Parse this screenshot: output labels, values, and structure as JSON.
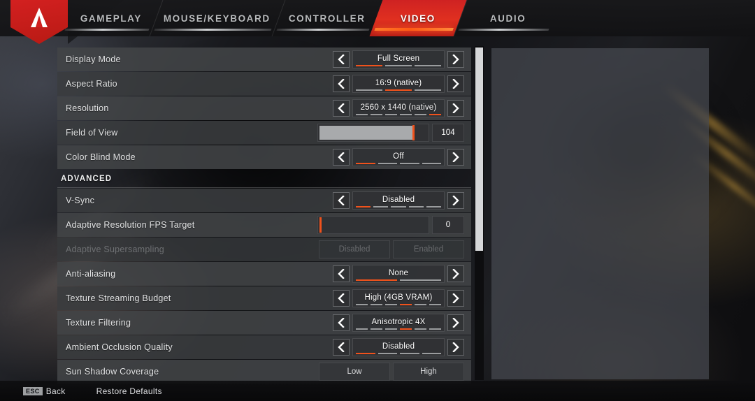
{
  "app": {
    "logo_icon": "apex-legends-logo-icon"
  },
  "tabs": [
    {
      "label": "GAMEPLAY",
      "active": false
    },
    {
      "label": "MOUSE/KEYBOARD",
      "active": false
    },
    {
      "label": "CONTROLLER",
      "active": false
    },
    {
      "label": "VIDEO",
      "active": true
    },
    {
      "label": "AUDIO",
      "active": false
    }
  ],
  "sections": [
    {
      "header": null,
      "rows": [
        {
          "label": "Display Mode",
          "type": "spinner",
          "value": "Full Screen",
          "segments": 3,
          "active_segment": 1,
          "disabled": false
        },
        {
          "label": "Aspect Ratio",
          "type": "spinner",
          "value": "16:9 (native)",
          "segments": 3,
          "active_segment": 2,
          "disabled": false
        },
        {
          "label": "Resolution",
          "type": "spinner",
          "value": "2560 x 1440 (native)",
          "segments": 6,
          "active_segment": 6,
          "disabled": false
        },
        {
          "label": "Field of View",
          "type": "slider",
          "value": "104",
          "fill_percent": 88,
          "disabled": false
        },
        {
          "label": "Color Blind Mode",
          "type": "spinner",
          "value": "Off",
          "segments": 4,
          "active_segment": 1,
          "disabled": false
        }
      ]
    },
    {
      "header": "ADVANCED",
      "rows": [
        {
          "label": "V-Sync",
          "type": "spinner",
          "value": "Disabled",
          "segments": 5,
          "active_segment": 1,
          "disabled": false
        },
        {
          "label": "Adaptive Resolution FPS Target",
          "type": "slider",
          "value": "0",
          "fill_percent": 0,
          "disabled": false
        },
        {
          "label": "Adaptive Supersampling",
          "type": "toggle",
          "options": [
            "Disabled",
            "Enabled"
          ],
          "selected": null,
          "disabled": true
        },
        {
          "label": "Anti-aliasing",
          "type": "spinner",
          "value": "None",
          "segments": 2,
          "active_segment": 1,
          "disabled": false
        },
        {
          "label": "Texture Streaming Budget",
          "type": "spinner",
          "value": "High (4GB VRAM)",
          "segments": 6,
          "active_segment": 4,
          "disabled": false
        },
        {
          "label": "Texture Filtering",
          "type": "spinner",
          "value": "Anisotropic 4X",
          "segments": 6,
          "active_segment": 4,
          "disabled": false
        },
        {
          "label": "Ambient Occlusion Quality",
          "type": "spinner",
          "value": "Disabled",
          "segments": 4,
          "active_segment": 1,
          "disabled": false
        },
        {
          "label": "Sun Shadow Coverage",
          "type": "toggle",
          "options": [
            "Low",
            "High"
          ],
          "selected": null,
          "disabled": false
        }
      ]
    }
  ],
  "scrollbar": {
    "thumb_top_percent": 0.4,
    "thumb_height_percent": 61
  },
  "footer": {
    "back_key": "ESC",
    "back_label": "Back",
    "restore_label": "Restore Defaults"
  },
  "colors": {
    "accent_orange": "#f0521c",
    "accent_red": "#d32020",
    "panel_row": "#424447",
    "text_primary": "#e2e3e4"
  }
}
